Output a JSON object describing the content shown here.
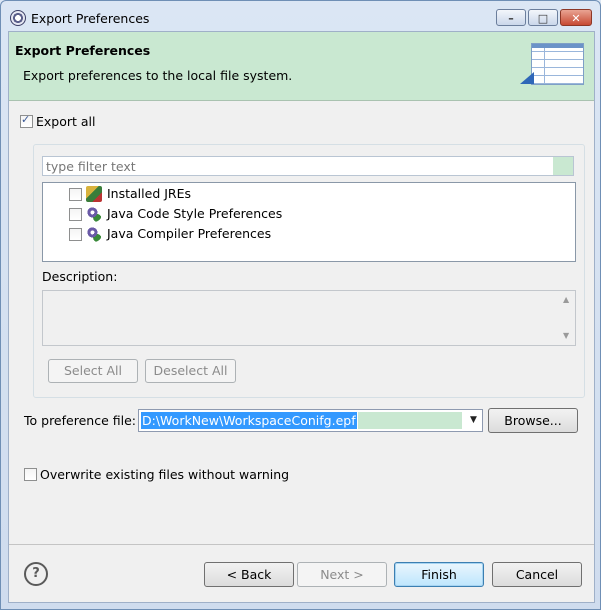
{
  "window": {
    "title": "Export Preferences",
    "controls": {
      "minimize": "▭",
      "maximize": "□",
      "close": "✕"
    }
  },
  "banner": {
    "title": "Export Preferences",
    "description": "Export preferences to the local file system.",
    "image": "export-wizard-icon"
  },
  "export_all": {
    "label": "Export all",
    "checked": true
  },
  "filter": {
    "placeholder": "type filter text"
  },
  "tree": {
    "items": [
      {
        "label": "Installed JREs",
        "icon": "jre-icon",
        "checked": false
      },
      {
        "label": "Java Code Style Preferences",
        "icon": "preference-icon",
        "checked": false
      },
      {
        "label": "Java Compiler Preferences",
        "icon": "preference-icon",
        "checked": false
      }
    ]
  },
  "description": {
    "label": "Description:",
    "text": ""
  },
  "buttons": {
    "select_all": "Select All",
    "deselect_all": "Deselect All",
    "browse": "Browse...",
    "back": "< Back",
    "next": "Next >",
    "finish": "Finish",
    "cancel": "Cancel"
  },
  "to_file": {
    "label": "To preference file:",
    "value": "D:\\WorkNew\\WorkspaceConifg.epf"
  },
  "overwrite": {
    "label": "Overwrite existing files without warning",
    "checked": false
  },
  "help": {
    "glyph": "?"
  },
  "colors": {
    "banner": "#c9e8d1",
    "selection": "#3399ff"
  }
}
